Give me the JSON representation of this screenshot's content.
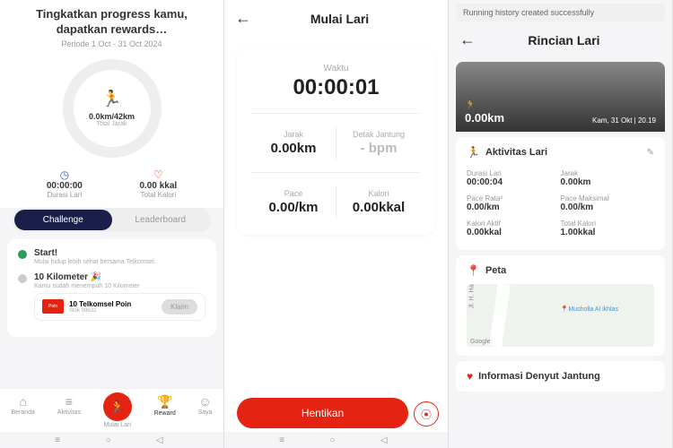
{
  "p1": {
    "title": "Tingkatkan progress kamu, dapatkan rewards…",
    "period": "Periode 1 Oct - 31 Oct 2024",
    "ring_value": "0.0km/42km",
    "ring_label": "Total Jarak",
    "duration_val": "00:00:00",
    "duration_lbl": "Durasi Lari",
    "calorie_val": "0.00 kkal",
    "calorie_lbl": "Total Kalori",
    "tab_challenge": "Challenge",
    "tab_leaderboard": "Leaderboard",
    "timeline": [
      {
        "title": "Start!",
        "sub": "Mulai hidup lebih sehat bersama Telkomsel."
      },
      {
        "title": "10 Kilometer 🎉",
        "sub": "Kamu sudah menempuh 10 Kilometer"
      }
    ],
    "reward": {
      "title": "10 Telkomsel Poin",
      "stock": "Stok 99632",
      "btn": "Klaim",
      "badge": "Poin"
    },
    "nav": [
      "Beranda",
      "Aktivitas",
      "Mulai Lari",
      "Reward",
      "Saya"
    ]
  },
  "p2": {
    "header": "Mulai Lari",
    "waktu_lbl": "Waktu",
    "waktu_val": "00:00:01",
    "jarak_lbl": "Jarak",
    "jarak_val": "0.00km",
    "bpm_lbl": "Detak Jantung",
    "bpm_val": "- bpm",
    "pace_lbl": "Pace",
    "pace_val": "0.00/km",
    "kalori_lbl": "Kalori",
    "kalori_val": "0.00kkal",
    "stop": "Hentikan"
  },
  "p3": {
    "toast": "Running history created successfully",
    "header": "Rincian Lari",
    "hero_dist": "0.00km",
    "hero_date": "Kam, 31 Okt | 20.19",
    "activity_title": "Aktivitas Lari",
    "stats": [
      {
        "l": "Durasi Lari",
        "v": "00:00:04"
      },
      {
        "l": "Jarak",
        "v": "0.00km"
      },
      {
        "l": "Pace Rata²",
        "v": "0.00/km"
      },
      {
        "l": "Pace Maksimal",
        "v": "0.00/km"
      },
      {
        "l": "Kalori Aktif",
        "v": "0.00kkal"
      },
      {
        "l": "Total Kalori",
        "v": "1.00kkal"
      }
    ],
    "peta_title": "Peta",
    "map_road": "Jl. H. Harun",
    "map_pin": "Musholla Al ikhlas",
    "map_google": "Google",
    "heart_title": "Informasi Denyut Jantung"
  }
}
